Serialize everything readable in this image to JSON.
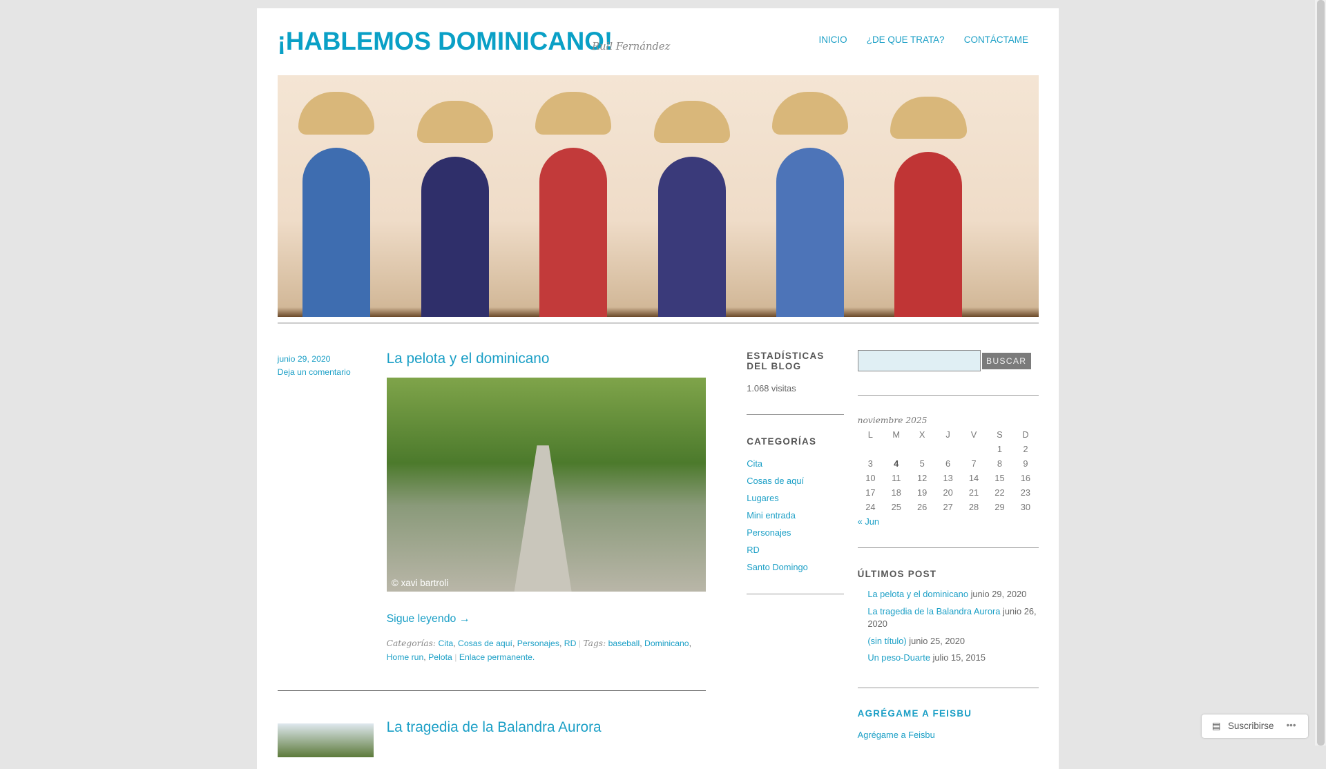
{
  "header": {
    "title": "¡HABLEMOS DOMINICANO!",
    "tagline": "Rull Fernández",
    "nav": [
      "INICIO",
      "¿DE QUE TRATA?",
      "CONTÁCTAME"
    ]
  },
  "post1": {
    "date": "junio 29, 2020",
    "comment_link": "Deja un comentario",
    "title": "La pelota y el dominicano",
    "image_credit": "© xavi bartroli",
    "read_more": "Sigue leyendo →",
    "categories_label": "Categorías:",
    "categories": [
      "Cita",
      "Cosas de aquí",
      "Personajes",
      "RD"
    ],
    "tags_label": "Tags:",
    "tags": [
      "baseball",
      "Dominicano",
      "Home run",
      "Pelota"
    ],
    "permalink": "Enlace permanente."
  },
  "post2": {
    "title": "La tragedia de la Balandra Aurora"
  },
  "stats": {
    "title": "ESTADÍSTICAS DEL BLOG",
    "visits": "1.068 visitas"
  },
  "categories": {
    "title": "CATEGORÍAS",
    "items": [
      "Cita",
      "Cosas de aquí",
      "Lugares",
      "Mini entrada",
      "Personajes",
      "RD",
      "Santo Domingo"
    ]
  },
  "search": {
    "value": "",
    "button": "BUSCAR"
  },
  "calendar": {
    "caption": "noviembre 2025",
    "days": [
      "L",
      "M",
      "X",
      "J",
      "V",
      "S",
      "D"
    ],
    "weeks": [
      [
        "",
        "",
        "",
        "",
        "",
        "1",
        "2"
      ],
      [
        "3",
        "4",
        "5",
        "6",
        "7",
        "8",
        "9"
      ],
      [
        "10",
        "11",
        "12",
        "13",
        "14",
        "15",
        "16"
      ],
      [
        "17",
        "18",
        "19",
        "20",
        "21",
        "22",
        "23"
      ],
      [
        "24",
        "25",
        "26",
        "27",
        "28",
        "29",
        "30"
      ]
    ],
    "today": "4",
    "prev": "« Jun"
  },
  "recent": {
    "title": "ÚLTIMOS POST",
    "items": [
      {
        "title": "La pelota y el dominicano",
        "date": "junio 29, 2020"
      },
      {
        "title": "La tragedia de la Balandra Aurora",
        "date": "junio 26, 2020"
      },
      {
        "title": "(sin título)",
        "date": "junio 25, 2020"
      },
      {
        "title": "Un peso-Duarte",
        "date": "julio 15, 2015"
      }
    ]
  },
  "facebook": {
    "title": "AGRÉGAME A FEISBU",
    "link": "Agrégame a Feisbu"
  },
  "subscribe": {
    "label": "Suscribirse",
    "more": "•••"
  }
}
